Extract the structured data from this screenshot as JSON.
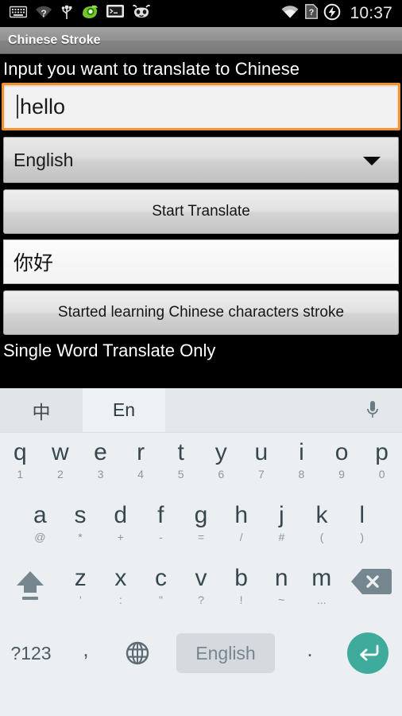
{
  "status_bar": {
    "icons": [
      "keyboard-icon",
      "wifi-unknown-icon",
      "usb-icon",
      "dolphin-browser-icon",
      "terminal-icon",
      "cyanogenmod-icon"
    ],
    "right_icons": [
      "wifi-signal-icon",
      "sim-unknown-icon",
      "charging-bolt-icon"
    ],
    "clock": "10:37"
  },
  "title_bar": {
    "title": "Chinese Stroke"
  },
  "app": {
    "prompt_label": "Input you want to translate to Chinese",
    "input": {
      "value": "hello",
      "placeholder": ""
    },
    "spinner": {
      "selected": "English",
      "icon": "chevron-down-icon"
    },
    "translate_button": "Start Translate",
    "result": "你好",
    "learn_button": "Started learning Chinese characters stroke",
    "footnote": "Single Word Translate Only"
  },
  "keyboard": {
    "tabs": [
      {
        "label": "中",
        "active": false
      },
      {
        "label": "En",
        "active": true
      }
    ],
    "mic_icon": "microphone-icon",
    "row1": [
      {
        "main": "q",
        "sub": "1"
      },
      {
        "main": "w",
        "sub": "2"
      },
      {
        "main": "e",
        "sub": "3"
      },
      {
        "main": "r",
        "sub": "4"
      },
      {
        "main": "t",
        "sub": "5"
      },
      {
        "main": "y",
        "sub": "6"
      },
      {
        "main": "u",
        "sub": "7"
      },
      {
        "main": "i",
        "sub": "8"
      },
      {
        "main": "o",
        "sub": "9"
      },
      {
        "main": "p",
        "sub": "0"
      }
    ],
    "row2": [
      {
        "main": "a",
        "sub": "@"
      },
      {
        "main": "s",
        "sub": "*"
      },
      {
        "main": "d",
        "sub": "+"
      },
      {
        "main": "f",
        "sub": "-"
      },
      {
        "main": "g",
        "sub": "="
      },
      {
        "main": "h",
        "sub": "/"
      },
      {
        "main": "j",
        "sub": "#"
      },
      {
        "main": "k",
        "sub": "("
      },
      {
        "main": "l",
        "sub": ")"
      }
    ],
    "row3": [
      {
        "main": "z",
        "sub": "'"
      },
      {
        "main": "x",
        "sub": ":"
      },
      {
        "main": "c",
        "sub": "\""
      },
      {
        "main": "v",
        "sub": "?"
      },
      {
        "main": "b",
        "sub": "!"
      },
      {
        "main": "n",
        "sub": "~"
      },
      {
        "main": "m",
        "sub": "..."
      }
    ],
    "shift_icon": "shift-up-arrow-icon",
    "backspace_icon": "backspace-delete-icon",
    "row4": {
      "symbols_label": "?123",
      "comma_label": ",",
      "globe_icon": "globe-language-icon",
      "space_label": "English",
      "period_label": ".",
      "enter_icon": "enter-return-icon"
    }
  },
  "colors": {
    "accent_focus": "#f0912c",
    "enter_key": "#3fab9c",
    "keyboard_bg": "#eceff1",
    "key_text": "#37474f"
  }
}
